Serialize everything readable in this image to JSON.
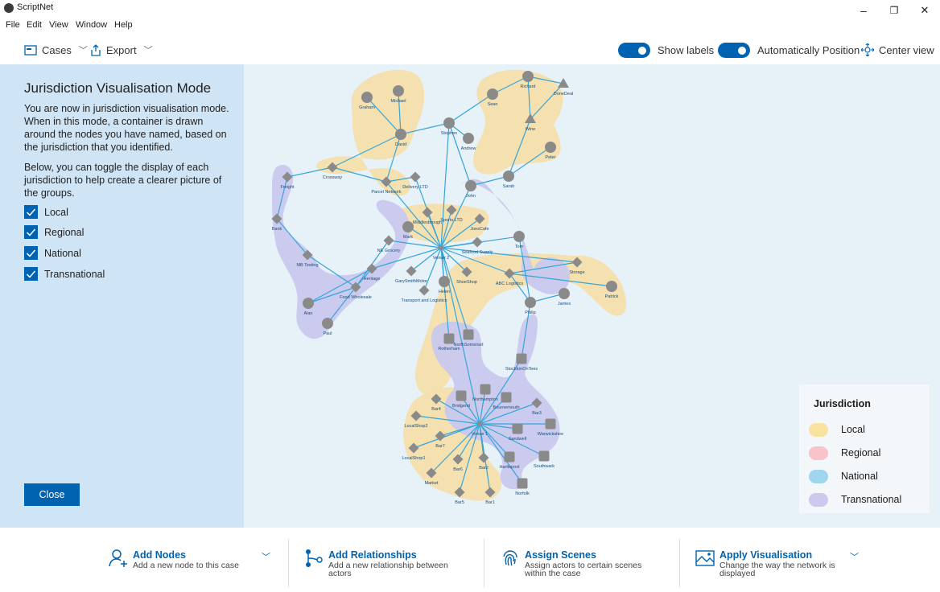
{
  "window": {
    "app_name": "ScriptNet",
    "minimize": "–",
    "restore": "❐",
    "close": "✕"
  },
  "menu": [
    "File",
    "Edit",
    "View",
    "Window",
    "Help"
  ],
  "toolbar": {
    "cases_label": "Cases",
    "export_label": "Export",
    "show_labels": "Show labels",
    "show_labels_on": true,
    "auto_position": "Automatically Position",
    "auto_position_on": true,
    "center_view": "Center view"
  },
  "panel": {
    "title": "Jurisdiction Visualisation Mode",
    "para1": "You are now in jurisdiction visualisation mode. When in this mode, a container is drawn around the nodes you have named, based on the jurisdiction that you identified.",
    "para2": "Below, you can toggle the display of each jurisdiction to help create a clearer picture of the groups.",
    "checks": [
      {
        "label": "Local",
        "checked": true
      },
      {
        "label": "Regional",
        "checked": true
      },
      {
        "label": "National",
        "checked": true
      },
      {
        "label": "Transnational",
        "checked": true
      }
    ],
    "close_label": "Close"
  },
  "legend": {
    "title": "Jurisdiction",
    "items": [
      {
        "label": "Local",
        "color": "#f9e1a0"
      },
      {
        "label": "Regional",
        "color": "#f8c3cb"
      },
      {
        "label": "National",
        "color": "#9fd6ee"
      },
      {
        "label": "Transnational",
        "color": "#cdc9ee"
      }
    ]
  },
  "colors": {
    "accent": "#0063b1",
    "edge": "#35a5d9",
    "node": "#8a8a8a",
    "local_hull": "#f6deac",
    "transnational_hull": "#c9c8ee"
  },
  "graph": {
    "labels": {
      "michael": "Michael",
      "graham": "Graham",
      "richard": "Richard",
      "donedeal": "DoneDeal",
      "sean": "Sean",
      "wine": "Wine",
      "stephen": "Stephen",
      "david": "David",
      "andrew": "Andrew",
      "peter": "Peter",
      "crossway": "Crossway",
      "freight": "Freight",
      "parcel": "Parcel Network",
      "delivery": "Delivery LTD",
      "sarah": "Sarah",
      "john": "John",
      "sports": "Sports LTD",
      "bank": "Bank",
      "middlesbrough": "Middlesbrough",
      "joescafe": "JoesCafe",
      "mark": "Mark",
      "tom": "Tom",
      "ne_grocery": "NE Grocery",
      "venue2": "Venue 2",
      "seafood": "Seafood Supply",
      "mb_testing": "MB Testing",
      "heritage": "Heritage",
      "gary": "GarySmithMotor",
      "storage": "Storage",
      "shoeshop": "ShoeShop",
      "abc": "ABC Logistics",
      "patrick": "Patrick",
      "helen": "Helen",
      "food_wholesale": "Food Wholesale",
      "transport": "Transport and Logistics",
      "james": "James",
      "alan": "Alan",
      "philip": "Philip",
      "paul": "Paul",
      "rotherham": "Rotherham",
      "north_somerset": "NorthSomerset",
      "stockton": "StocktonOnTees",
      "northampton": "Northampton",
      "bar4": "Bar4",
      "bridgend": "Bridgend",
      "bournemouth": "Bournemouth",
      "bar3": "Bar3",
      "localshop2": "LocalShop2",
      "venue1": "Venue 1",
      "sandwell": "Sandwell",
      "warwickshire": "Warwickshire",
      "bar7": "Bar7",
      "localshop1": "LocalShop1",
      "hartlepool": "Hartlepool",
      "southwark": "Southwark",
      "bar6": "Bar6",
      "bar2": "Bar2",
      "market": "Market",
      "norfolk": "Norfolk",
      "bar5": "Bar5",
      "bar1": "Bar1"
    },
    "nodes": [
      {
        "id": "michael",
        "shape": "circle"
      },
      {
        "id": "graham",
        "shape": "circle"
      },
      {
        "id": "richard",
        "shape": "circle"
      },
      {
        "id": "donedeal",
        "shape": "triangle"
      },
      {
        "id": "sean",
        "shape": "circle"
      },
      {
        "id": "wine",
        "shape": "triangle"
      },
      {
        "id": "stephen",
        "shape": "circle"
      },
      {
        "id": "david",
        "shape": "circle"
      },
      {
        "id": "andrew",
        "shape": "circle"
      },
      {
        "id": "peter",
        "shape": "circle"
      },
      {
        "id": "crossway",
        "shape": "diamond"
      },
      {
        "id": "freight",
        "shape": "diamond"
      },
      {
        "id": "parcel",
        "shape": "diamond"
      },
      {
        "id": "delivery",
        "shape": "diamond"
      },
      {
        "id": "sarah",
        "shape": "circle"
      },
      {
        "id": "john",
        "shape": "circle"
      },
      {
        "id": "sports",
        "shape": "diamond"
      },
      {
        "id": "bank",
        "shape": "diamond"
      },
      {
        "id": "middlesbrough",
        "shape": "diamond"
      },
      {
        "id": "joescafe",
        "shape": "diamond"
      },
      {
        "id": "mark",
        "shape": "circle"
      },
      {
        "id": "tom",
        "shape": "circle"
      },
      {
        "id": "ne_grocery",
        "shape": "diamond"
      },
      {
        "id": "venue2",
        "shape": "star"
      },
      {
        "id": "seafood",
        "shape": "diamond"
      },
      {
        "id": "mb_testing",
        "shape": "diamond"
      },
      {
        "id": "heritage",
        "shape": "diamond"
      },
      {
        "id": "gary",
        "shape": "diamond"
      },
      {
        "id": "storage",
        "shape": "diamond"
      },
      {
        "id": "shoeshop",
        "shape": "diamond"
      },
      {
        "id": "abc",
        "shape": "diamond"
      },
      {
        "id": "patrick",
        "shape": "circle"
      },
      {
        "id": "helen",
        "shape": "circle"
      },
      {
        "id": "food_wholesale",
        "shape": "diamond"
      },
      {
        "id": "transport",
        "shape": "diamond"
      },
      {
        "id": "james",
        "shape": "circle"
      },
      {
        "id": "alan",
        "shape": "circle"
      },
      {
        "id": "philip",
        "shape": "circle"
      },
      {
        "id": "paul",
        "shape": "circle"
      },
      {
        "id": "rotherham",
        "shape": "square"
      },
      {
        "id": "north_somerset",
        "shape": "square"
      },
      {
        "id": "stockton",
        "shape": "square"
      },
      {
        "id": "northampton",
        "shape": "square"
      },
      {
        "id": "bar4",
        "shape": "diamond"
      },
      {
        "id": "bridgend",
        "shape": "square"
      },
      {
        "id": "bournemouth",
        "shape": "square"
      },
      {
        "id": "bar3",
        "shape": "diamond"
      },
      {
        "id": "localshop2",
        "shape": "diamond"
      },
      {
        "id": "venue1",
        "shape": "star"
      },
      {
        "id": "sandwell",
        "shape": "square"
      },
      {
        "id": "warwickshire",
        "shape": "square"
      },
      {
        "id": "bar7",
        "shape": "diamond"
      },
      {
        "id": "localshop1",
        "shape": "diamond"
      },
      {
        "id": "hartlepool",
        "shape": "square"
      },
      {
        "id": "southwark",
        "shape": "square"
      },
      {
        "id": "bar6",
        "shape": "diamond"
      },
      {
        "id": "bar2",
        "shape": "diamond"
      },
      {
        "id": "market",
        "shape": "diamond"
      },
      {
        "id": "norfolk",
        "shape": "square"
      },
      {
        "id": "bar5",
        "shape": "diamond"
      },
      {
        "id": "bar1",
        "shape": "diamond"
      }
    ],
    "edges": [
      [
        "michael",
        "david"
      ],
      [
        "graham",
        "david"
      ],
      [
        "david",
        "stephen"
      ],
      [
        "david",
        "crossway"
      ],
      [
        "david",
        "parcel"
      ],
      [
        "sean",
        "richard"
      ],
      [
        "sean",
        "stephen"
      ],
      [
        "richard",
        "donedeal"
      ],
      [
        "richard",
        "wine"
      ],
      [
        "donedeal",
        "wine"
      ],
      [
        "wine",
        "sarah"
      ],
      [
        "stephen",
        "andrew"
      ],
      [
        "stephen",
        "john"
      ],
      [
        "stephen",
        "venue2"
      ],
      [
        "peter",
        "sarah"
      ],
      [
        "sarah",
        "john"
      ],
      [
        "john",
        "venue2"
      ],
      [
        "crossway",
        "freight"
      ],
      [
        "crossway",
        "parcel"
      ],
      [
        "freight",
        "bank"
      ],
      [
        "bank",
        "mb_testing"
      ],
      [
        "mb_testing",
        "food_wholesale"
      ],
      [
        "parcel",
        "delivery"
      ],
      [
        "parcel",
        "venue2"
      ],
      [
        "delivery",
        "venue2"
      ],
      [
        "venue2",
        "sports"
      ],
      [
        "venue2",
        "middlesbrough"
      ],
      [
        "venue2",
        "joescafe"
      ],
      [
        "venue2",
        "mark"
      ],
      [
        "venue2",
        "ne_grocery"
      ],
      [
        "venue2",
        "seafood"
      ],
      [
        "venue2",
        "heritage"
      ],
      [
        "venue2",
        "gary"
      ],
      [
        "venue2",
        "shoeshop"
      ],
      [
        "venue2",
        "helen"
      ],
      [
        "venue2",
        "transport"
      ],
      [
        "venue2",
        "abc"
      ],
      [
        "venue2",
        "tom"
      ],
      [
        "venue2",
        "storage"
      ],
      [
        "venue2",
        "rotherham"
      ],
      [
        "venue2",
        "north_somerset"
      ],
      [
        "venue2",
        "venue1"
      ],
      [
        "ne_grocery",
        "food_wholesale"
      ],
      [
        "heritage",
        "food_wholesale"
      ],
      [
        "heritage",
        "alan"
      ],
      [
        "food_wholesale",
        "paul"
      ],
      [
        "food_wholesale",
        "alan"
      ],
      [
        "abc",
        "philip"
      ],
      [
        "abc",
        "patrick"
      ],
      [
        "abc",
        "storage"
      ],
      [
        "philip",
        "james"
      ],
      [
        "philip",
        "tom"
      ],
      [
        "philip",
        "stockton"
      ],
      [
        "stockton",
        "venue1"
      ],
      [
        "venue1",
        "northampton"
      ],
      [
        "venue1",
        "bar4"
      ],
      [
        "venue1",
        "bridgend"
      ],
      [
        "venue1",
        "bournemouth"
      ],
      [
        "venue1",
        "bar3"
      ],
      [
        "venue1",
        "localshop2"
      ],
      [
        "venue1",
        "sandwell"
      ],
      [
        "venue1",
        "warwickshire"
      ],
      [
        "venue1",
        "bar7"
      ],
      [
        "venue1",
        "localshop1"
      ],
      [
        "venue1",
        "hartlepool"
      ],
      [
        "venue1",
        "southwark"
      ],
      [
        "venue1",
        "bar6"
      ],
      [
        "venue1",
        "bar2"
      ],
      [
        "venue1",
        "market"
      ],
      [
        "venue1",
        "norfolk"
      ],
      [
        "venue1",
        "bar5"
      ],
      [
        "venue1",
        "bar1"
      ]
    ]
  },
  "actions": [
    {
      "title": "Add Nodes",
      "desc": "Add a new node to this case",
      "icon": "person-add-icon"
    },
    {
      "title": "Add Relationships",
      "desc": "Add a new relationship between actors",
      "icon": "relationship-icon"
    },
    {
      "title": "Assign Scenes",
      "desc": "Assign actors to certain scenes within the case",
      "icon": "fingerprint-icon"
    },
    {
      "title": "Apply Visualisation",
      "desc": "Change the way the network is displayed",
      "icon": "picture-icon"
    }
  ]
}
